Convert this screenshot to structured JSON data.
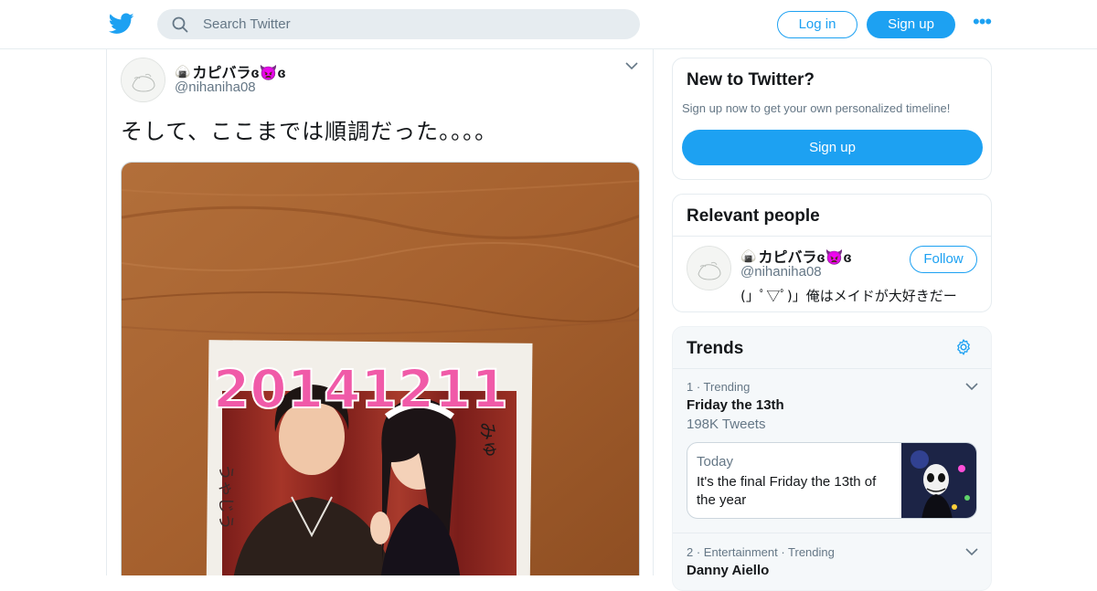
{
  "header": {
    "search_placeholder": "Search Twitter",
    "login_label": "Log in",
    "signup_label": "Sign up",
    "more_label": "•••",
    "icons": [
      "twitter-bird-icon",
      "search-icon",
      "more-dots-icon"
    ],
    "accent_color": "#1da1f2"
  },
  "tweet": {
    "display_name": "カピバラɞ👿ɞ",
    "name_prefix_emoji": "🍙",
    "handle": "@nihaniha08",
    "text": "そして、ここまでは順調だった。。。。",
    "photo": {
      "date_text": "20141211",
      "side_signature_left": "うゃじう",
      "side_signature_right": "みゅ"
    }
  },
  "new_to_twitter": {
    "title": "New to Twitter?",
    "subtitle": "Sign up now to get your own personalized timeline!",
    "signup_label": "Sign up"
  },
  "relevant_people": {
    "title": "Relevant people",
    "person": {
      "display_name": "カピバラɞ👿ɞ",
      "name_prefix_emoji": "🍙",
      "handle": "@nihaniha08",
      "bio": "(」ﾟ▽ﾟ)」俺はメイドが大好きだー",
      "follow_label": "Follow"
    }
  },
  "trends": {
    "title": "Trends",
    "items": [
      {
        "meta": "1 · Trending",
        "name": "Friday the 13th",
        "count": "198K Tweets",
        "news": {
          "when": "Today",
          "text": "It's the final Friday the 13th of the year"
        }
      },
      {
        "meta": "2 · Entertainment · Trending",
        "name": "Danny Aiello"
      }
    ]
  }
}
